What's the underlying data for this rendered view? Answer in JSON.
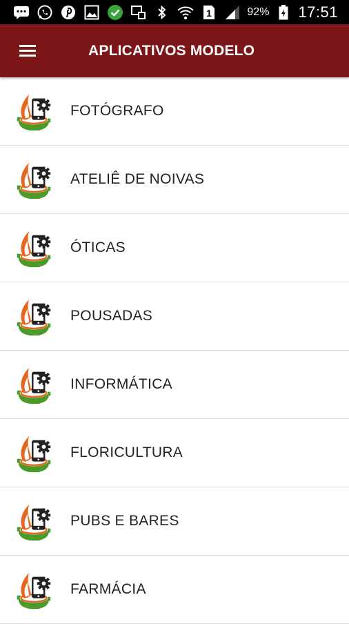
{
  "status_bar": {
    "battery_percent": "92%",
    "time": "17:51",
    "sim_slot": "1",
    "icons": [
      "messages-icon",
      "whatsapp-icon",
      "pinterest-icon",
      "gallery-icon",
      "check-icon",
      "screencast-icon",
      "bluetooth-icon",
      "wifi-icon",
      "sim-icon",
      "signal-icon",
      "battery-icon"
    ]
  },
  "app_bar": {
    "title": "APLICATIVOS MODELO",
    "menu_icon": "hamburger-menu-icon",
    "color": "#7d1619"
  },
  "list": {
    "items": [
      {
        "label": "FOTÓGRAFO"
      },
      {
        "label": "ATELIÊ DE NOIVAS"
      },
      {
        "label": "ÓTICAS"
      },
      {
        "label": "POUSADAS"
      },
      {
        "label": "INFORMÁTICA"
      },
      {
        "label": "FLORICULTURA"
      },
      {
        "label": "PUBS E BARES"
      },
      {
        "label": "FARMÁCIA"
      }
    ],
    "item_icon": "app-logo-icon"
  }
}
